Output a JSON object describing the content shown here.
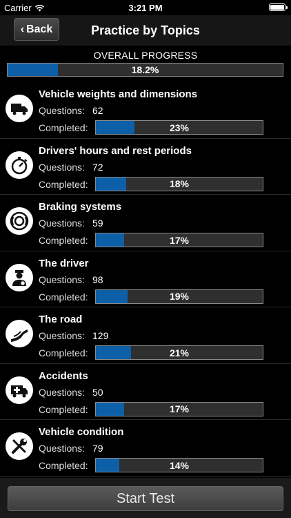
{
  "status": {
    "carrier": "Carrier",
    "time": "3:21 PM"
  },
  "nav": {
    "back_label": "Back",
    "title": "Practice by Topics"
  },
  "overall": {
    "label": "OVERALL PROGRESS",
    "percent": 18.2,
    "percent_text": "18.2%"
  },
  "labels": {
    "questions": "Questions:",
    "completed": "Completed:"
  },
  "topics": [
    {
      "title": "Vehicle weights and dimensions",
      "questions": "62",
      "completed": 23,
      "completed_text": "23%",
      "icon": "truck-icon"
    },
    {
      "title": "Drivers' hours and rest periods",
      "questions": "72",
      "completed": 18,
      "completed_text": "18%",
      "icon": "stopwatch-icon"
    },
    {
      "title": "Braking systems",
      "questions": "59",
      "completed": 17,
      "completed_text": "17%",
      "icon": "brake-icon"
    },
    {
      "title": "The driver",
      "questions": "98",
      "completed": 19,
      "completed_text": "19%",
      "icon": "driver-icon"
    },
    {
      "title": "The road",
      "questions": "129",
      "completed": 21,
      "completed_text": "21%",
      "icon": "road-icon"
    },
    {
      "title": "Accidents",
      "questions": "50",
      "completed": 17,
      "completed_text": "17%",
      "icon": "ambulance-icon"
    },
    {
      "title": "Vehicle condition",
      "questions": "79",
      "completed": 14,
      "completed_text": "14%",
      "icon": "tools-icon"
    }
  ],
  "start_button": {
    "label": "Start Test"
  },
  "colors": {
    "progress_fill": "#0d60a8",
    "bar_track": "#2f2f2f"
  }
}
